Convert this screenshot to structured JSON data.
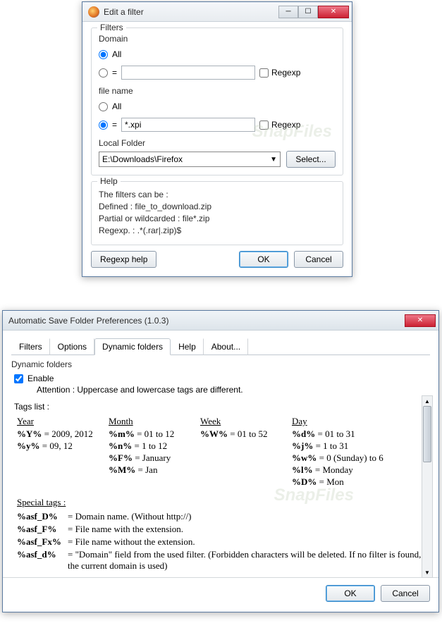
{
  "win1": {
    "title": "Edit a filter",
    "filters": {
      "legend": "Filters",
      "domain": {
        "label": "Domain",
        "all": "All",
        "eq": "=",
        "value": "",
        "regexp": "Regexp"
      },
      "filename": {
        "label": "file name",
        "all": "All",
        "eq": "=",
        "value": "*.xpi",
        "regexp": "Regexp"
      },
      "localfolder": {
        "label": "Local Folder",
        "value": "E:\\Downloads\\Firefox",
        "select_btn": "Select..."
      }
    },
    "help": {
      "legend": "Help",
      "lines": [
        "The filters can be :",
        "Defined : file_to_download.zip",
        "Partial or wildcarded : file*.zip",
        "Regexp. : .*(.rar|.zip)$"
      ]
    },
    "buttons": {
      "regexp_help": "Regexp help",
      "ok": "OK",
      "cancel": "Cancel"
    }
  },
  "win2": {
    "title": "Automatic Save Folder Preferences (1.0.3)",
    "tabs": [
      "Filters",
      "Options",
      "Dynamic folders",
      "Help",
      "About..."
    ],
    "active_tab": 2,
    "section": "Dynamic folders",
    "enable": "Enable",
    "attention": "Attention : Uppercase and lowercase tags are different.",
    "tagslist": "Tags list :",
    "cols": {
      "year": {
        "hd": "Year",
        "rows": [
          {
            "t": "%Y%",
            "v": "= 2009, 2012"
          },
          {
            "t": "%y%",
            "v": "= 09, 12"
          }
        ]
      },
      "month": {
        "hd": "Month",
        "rows": [
          {
            "t": "%m%",
            "v": "= 01 to 12"
          },
          {
            "t": "%n%",
            "v": "= 1 to 12"
          },
          {
            "t": "%F%",
            "v": "= January"
          },
          {
            "t": "%M%",
            "v": "= Jan"
          }
        ]
      },
      "week": {
        "hd": "Week",
        "rows": [
          {
            "t": "%W%",
            "v": "= 01 to 52"
          }
        ]
      },
      "day": {
        "hd": "Day",
        "rows": [
          {
            "t": "%d%",
            "v": "= 01 to 31"
          },
          {
            "t": "%j%",
            "v": "= 1 to 31"
          },
          {
            "t": "%w%",
            "v": "= 0 (Sunday) to 6"
          },
          {
            "t": "%l%",
            "v": "= Monday"
          },
          {
            "t": "%D%",
            "v": "= Mon"
          }
        ]
      }
    },
    "special": {
      "hd": "Special tags :",
      "rows": [
        {
          "t": "%asf_D%",
          "d": "= Domain name. (Without http://)"
        },
        {
          "t": "%asf_F%",
          "d": "= File name with the extension."
        },
        {
          "t": "%asf_Fx%",
          "d": "= File name without the extension."
        },
        {
          "t": "%asf_d%",
          "d": "= \"Domain\" field from the used filter. (Forbidden characters will be deleted. If no filter is found, the current domain is used)"
        }
      ]
    },
    "buttons": {
      "ok": "OK",
      "cancel": "Cancel"
    }
  },
  "watermark": "SnapFiles"
}
